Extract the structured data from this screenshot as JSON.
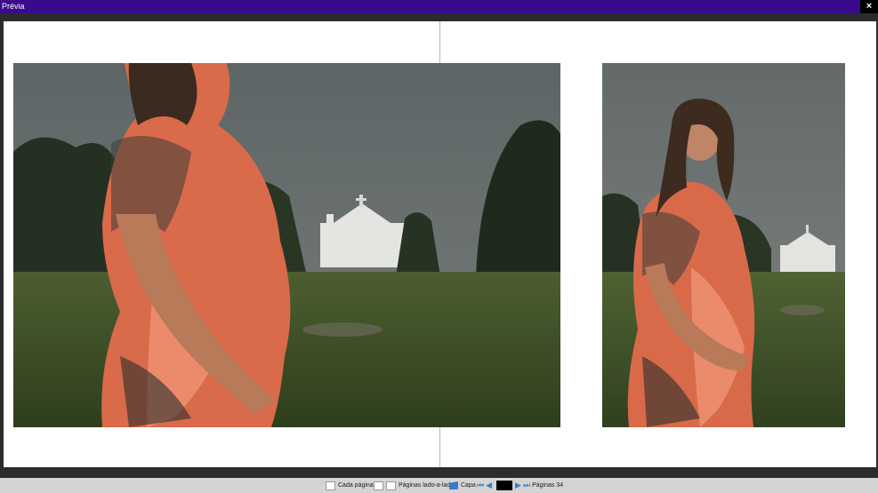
{
  "window": {
    "title": "Prévia",
    "close_symbol": "×"
  },
  "toolbar": {
    "cada_pagina_label": "Cada página",
    "lado_a_lado_label": "Páginas lado-a-lado",
    "capa_label": "Capa",
    "current_page": "",
    "pages_label": "Páginas 34"
  },
  "icons": {
    "first": "⏮",
    "prev": "◀",
    "next": "▶",
    "last": "⏭"
  },
  "colors": {
    "title_bar": "#3a0a8c",
    "accent": "#3b7ad0"
  }
}
